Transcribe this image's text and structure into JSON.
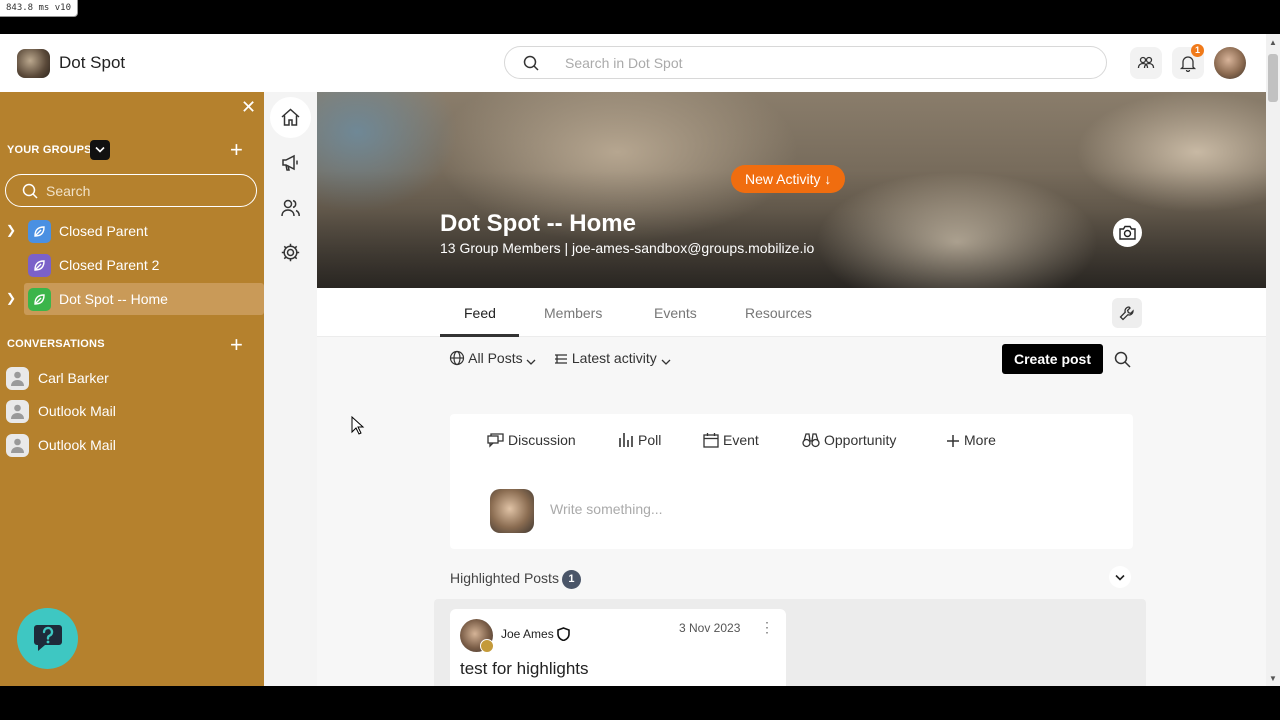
{
  "debug": "843.8 ms v10",
  "header": {
    "app_name": "Dot Spot",
    "search_placeholder": "Search in Dot Spot",
    "notification_count": "1"
  },
  "sidebar": {
    "groups_title": "YOUR GROUPS",
    "search_placeholder": "Search",
    "groups": [
      {
        "label": "Closed Parent",
        "color": "#4a90e2",
        "expandable": true
      },
      {
        "label": "Closed Parent 2",
        "color": "#7b61c9",
        "expandable": false
      },
      {
        "label": "Dot Spot -- Home",
        "color": "#3bb54a",
        "expandable": true
      }
    ],
    "conversations_title": "CONVERSATIONS",
    "conversations": [
      {
        "label": "Carl Barker"
      },
      {
        "label": "Outlook Mail"
      },
      {
        "label": "Outlook Mail"
      }
    ],
    "accent": "#b5812d"
  },
  "banner": {
    "new_activity": "New Activity",
    "title": "Dot Spot -- Home",
    "subtitle": "13 Group Members | joe-ames-sandbox@groups.mobilize.io"
  },
  "tabs": [
    {
      "label": "Feed",
      "active": true
    },
    {
      "label": "Members",
      "active": false
    },
    {
      "label": "Events",
      "active": false
    },
    {
      "label": "Resources",
      "active": false
    }
  ],
  "feed": {
    "filter_posts": "All Posts",
    "filter_sort": "Latest activity",
    "create_post": "Create post",
    "post_types": [
      "Discussion",
      "Poll",
      "Event",
      "Opportunity",
      "More"
    ],
    "composer_placeholder": "Write something...",
    "highlighted_title": "Highlighted Posts",
    "highlighted_count": "1",
    "highlighted_posts": [
      {
        "author": "Joe Ames",
        "date": "3 Nov 2023",
        "title": "test for highlights"
      }
    ]
  }
}
